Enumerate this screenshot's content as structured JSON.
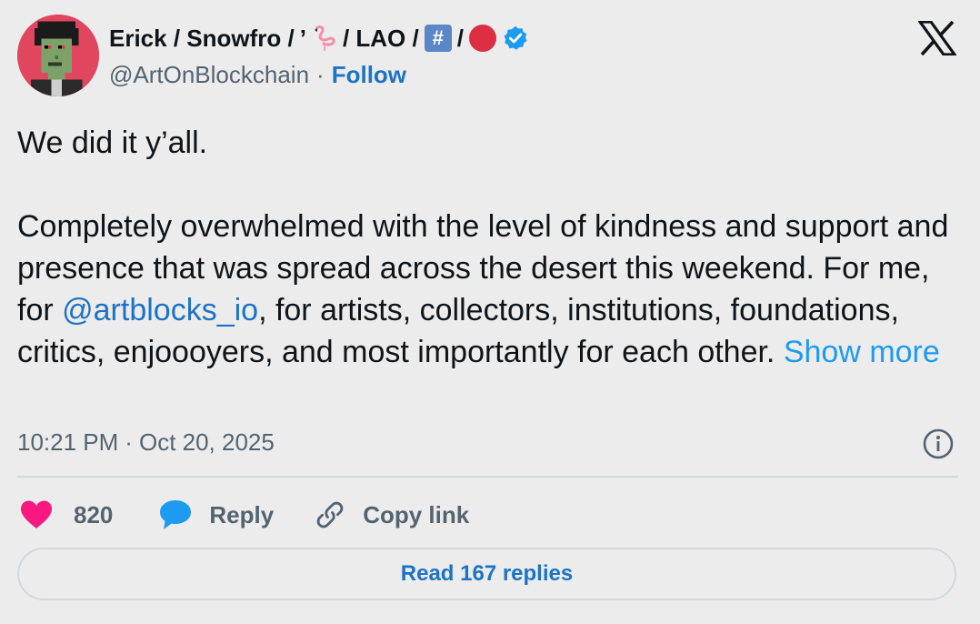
{
  "author": {
    "display_name_parts": [
      "Erick / Snowfro / ",
      "’",
      " / LAO / ",
      " / "
    ],
    "flamingo_emoji": "flamingo-icon",
    "hash_badge": "#",
    "handle": "@ArtOnBlockchain",
    "separator": "·",
    "follow_label": "Follow",
    "verified": true
  },
  "tweet": {
    "line1": "We did it y’all.",
    "para2_before_mention": "Completely overwhelmed with the level of kindness and support and presence that was spread across the desert this weekend. For me, for ",
    "mention": "@artblocks_io",
    "para2_after_mention": ", for artists, collectors, institutions, foundations, critics, enjoooyers, and most importantly for each other. ",
    "show_more": "Show more"
  },
  "meta": {
    "time": "10:21 PM",
    "separator": "·",
    "date": "Oct 20, 2025"
  },
  "actions": {
    "like_count": "820",
    "reply_label": "Reply",
    "copy_label": "Copy link"
  },
  "read_replies_label": "Read 167 replies",
  "colors": {
    "background": "#ececec",
    "link": "#1d73c5",
    "show_more": "#1d9bf0",
    "heart": "#f91880",
    "reply_bubble": "#1d9bf0",
    "verified": "#1d9bf0",
    "avatar_bg": "#e0475f"
  }
}
